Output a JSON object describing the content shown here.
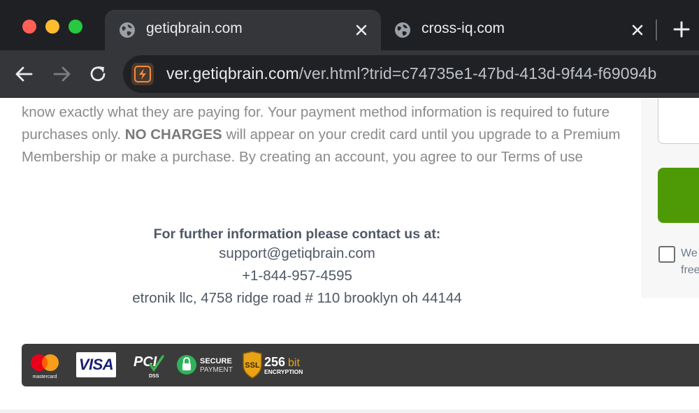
{
  "browser": {
    "tabs": [
      {
        "title": "getiqbrain.com",
        "active": true
      },
      {
        "title": "cross-iq.com",
        "active": false
      }
    ],
    "url_host": "ver.getiqbrain.com",
    "url_rest": "/ver.html?trid=c74735e1-47bd-413d-9f44-f69094b",
    "icons": {
      "back": "back-arrow-icon",
      "forward": "forward-arrow-icon",
      "reload": "reload-icon",
      "new_tab": "plus-icon",
      "close": "close-icon",
      "site": "lightning-icon",
      "globe": "globe-icon"
    }
  },
  "page": {
    "terms_part1": "know exactly what they are paying for. Your payment method information is required to future purchases only.",
    "terms_bold": "NO CHARGES",
    "terms_part2": "will appear on your credit card until you upgrade to a Premium Membership or make a purchase. By creating an account, you agree to our Terms of use",
    "contact": {
      "heading": "For further information please contact us at:",
      "email": "support@getiqbrain.com",
      "phone": "+1-844-957-4595",
      "address": "etronik llc, 4758 ridge road # 110 brooklyn oh 44144"
    },
    "side_form": {
      "checkbox_text_line1": "We",
      "checkbox_text_line2": "free"
    },
    "payment_logos": [
      {
        "name": "mastercard",
        "label": "mastercard"
      },
      {
        "name": "visa",
        "label": "VISA"
      },
      {
        "name": "pci",
        "label": "PCI",
        "sub": "DSS"
      },
      {
        "name": "secure-payment",
        "line1": "SECURE",
        "line2": "PAYMENT"
      },
      {
        "name": "ssl",
        "badge": "SSL",
        "bits": "256",
        "bit_label": "bit",
        "line2": "ENCRYPTION"
      }
    ],
    "colors": {
      "tabbar": "#1f2023",
      "toolbar": "#35363a",
      "green_button": "#4e9a06",
      "payment_bar": "#3b3b3b"
    }
  }
}
